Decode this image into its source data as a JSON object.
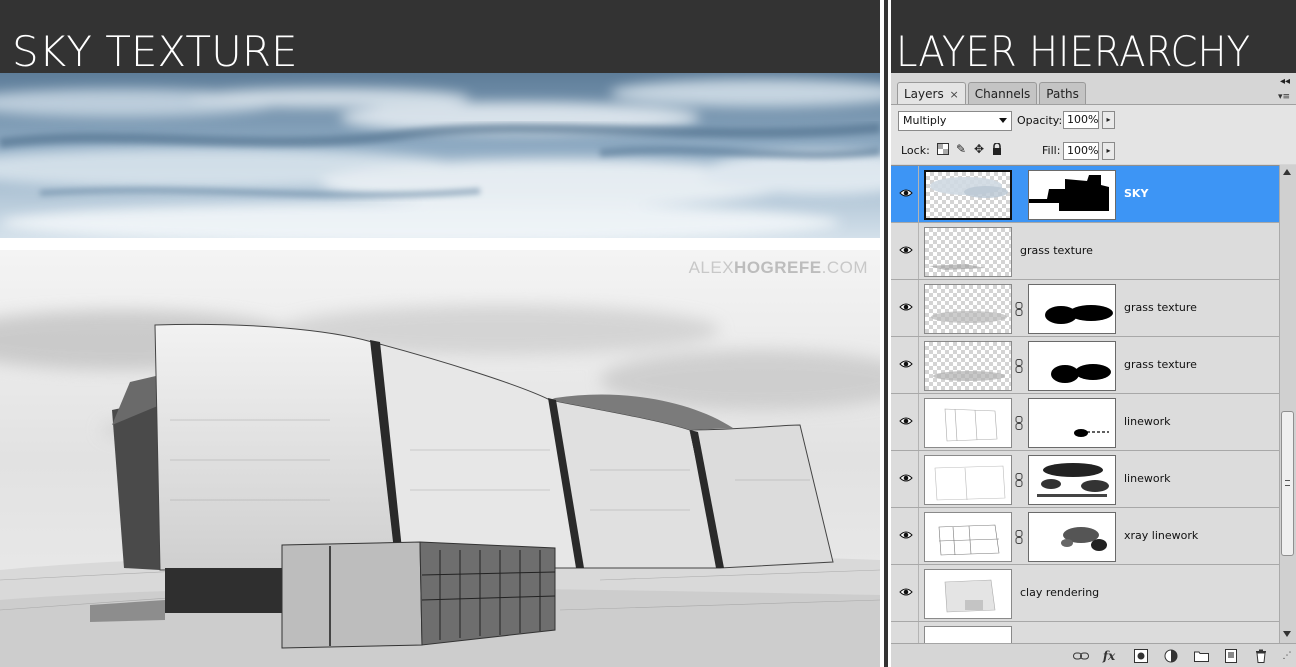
{
  "left": {
    "title": "SKY TEXTURE",
    "watermark_light": "ALEX",
    "watermark_bold": "HOGREFE",
    "watermark_suffix": ".COM"
  },
  "right": {
    "title": "LAYER HIERARCHY",
    "tabs": [
      {
        "label": "Layers",
        "close": "×",
        "active": true
      },
      {
        "label": "Channels",
        "active": false
      },
      {
        "label": "Paths",
        "active": false
      }
    ],
    "blend_mode": "Multiply",
    "opacity_label": "Opacity:",
    "opacity_value": "100%",
    "lock_label": "Lock:",
    "fill_label": "Fill:",
    "fill_value": "100%",
    "layers": [
      {
        "name": "SKY",
        "selected": true,
        "has_mask": true
      },
      {
        "name": "grass texture",
        "selected": false,
        "has_mask": false
      },
      {
        "name": "grass texture",
        "selected": false,
        "has_mask": true
      },
      {
        "name": "grass texture",
        "selected": false,
        "has_mask": true
      },
      {
        "name": "linework",
        "selected": false,
        "has_mask": true
      },
      {
        "name": "linework",
        "selected": false,
        "has_mask": true
      },
      {
        "name": "xray linework",
        "selected": false,
        "has_mask": true
      },
      {
        "name": "clay rendering",
        "selected": false,
        "has_mask": false
      }
    ],
    "bottom_icons": [
      "link-layers-icon",
      "fx-icon",
      "add-mask-icon",
      "adjustment-layer-icon",
      "new-group-icon",
      "new-layer-icon",
      "trash-icon"
    ],
    "colors": {
      "selection": "#3d95f5",
      "header": "#333333"
    }
  }
}
